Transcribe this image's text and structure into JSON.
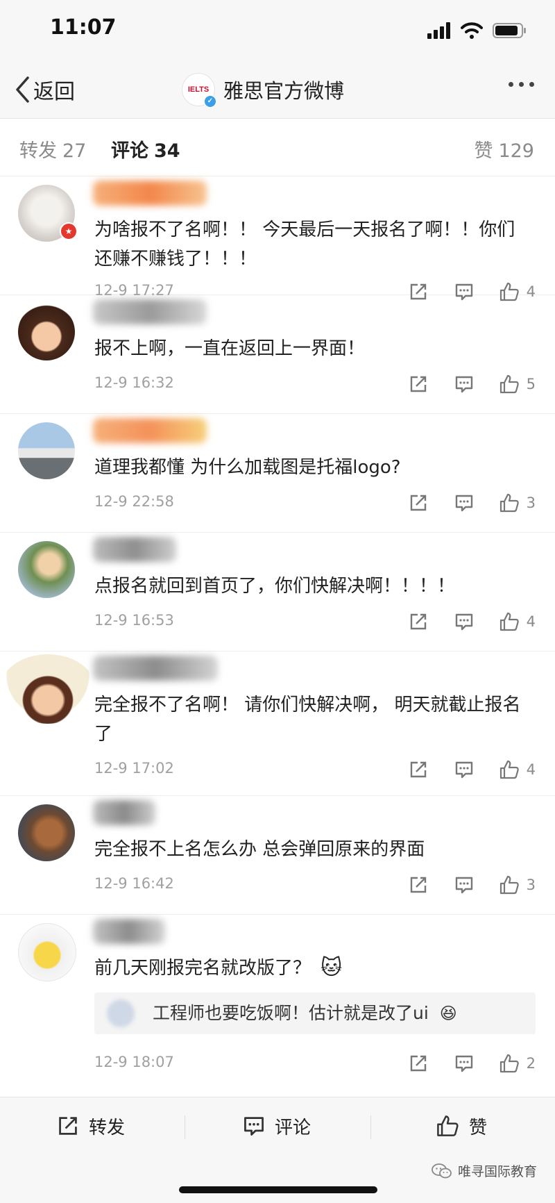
{
  "status_bar": {
    "time": "11:07"
  },
  "nav": {
    "back_label": "返回",
    "logo_text": "IELTS",
    "title": "雅思官方微博"
  },
  "tabs": {
    "repost_label": "转发",
    "repost_count": "27",
    "comment_label": "评论",
    "comment_count": "34",
    "like_label": "赞",
    "like_count": "129"
  },
  "comments": [
    {
      "text": "为啥报不了名啊！！ 今天最后一天报名了啊！！你们还赚不赚钱了！！！",
      "time": "12-9 17:27",
      "likes": "4"
    },
    {
      "text": "报不上啊，一直在返回上一界面！",
      "time": "12-9 16:32",
      "likes": "5"
    },
    {
      "text": "道理我都懂 为什么加载图是托福logo?",
      "time": "12-9 22:58",
      "likes": "3"
    },
    {
      "text": "点报名就回到首页了，你们快解决啊！！！！",
      "time": "12-9 16:53",
      "likes": "4"
    },
    {
      "text": "完全报不了名啊！ 请你们快解决啊， 明天就截止报名了",
      "time": "12-9 17:02",
      "likes": "4"
    },
    {
      "text": "完全报不上名怎么办 总会弹回原来的界面",
      "time": "12-9 16:42",
      "likes": "3"
    },
    {
      "text": "前几天刚报完名就改版了？",
      "time": "12-9 18:07",
      "likes": "2",
      "reply": "工程师也要吃饭啊！估计就是改了ui"
    }
  ],
  "bottom_bar": {
    "repost": "转发",
    "comment": "评论",
    "like": "赞"
  },
  "watermark": "唯寻国际教育",
  "colors": {
    "accent_blue": "#3a9ee8",
    "badge_red": "#e2382d",
    "meta_gray": "#a0a0a0"
  }
}
